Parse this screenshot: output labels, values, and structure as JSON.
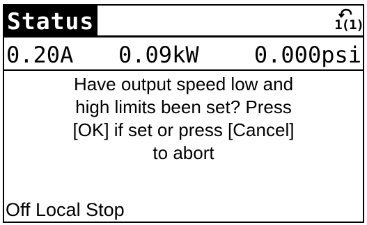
{
  "header": {
    "title": "Status",
    "menu_icon": "cycle-arrow-icon",
    "menu_number": "1(1)"
  },
  "readouts": {
    "current": "0.20A",
    "power": "0.09kW",
    "pressure": "0.000psi"
  },
  "message": {
    "lines": [
      "Have output speed low and",
      "high limits been set?  Press",
      "[OK] if set or press [Cancel]",
      "to abort"
    ]
  },
  "footer": {
    "status": "Off Local Stop"
  },
  "colors": {
    "background": "#ffffff",
    "foreground": "#000000"
  }
}
